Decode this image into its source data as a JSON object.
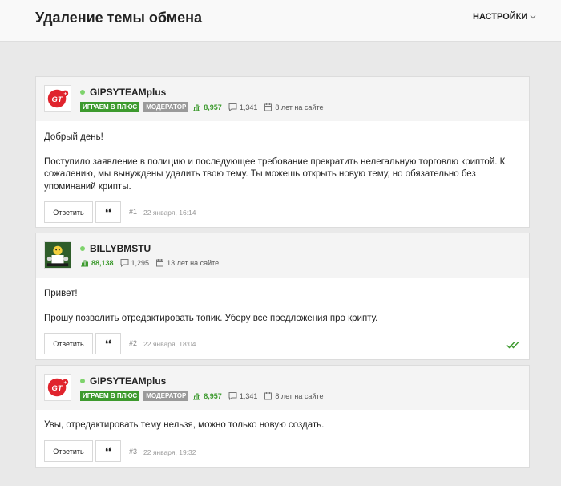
{
  "header": {
    "title": "Удаление темы обмена",
    "settings_label": "НАСТРОЙКИ"
  },
  "posts": [
    {
      "author": "GIPSYTEAMplus",
      "badge_group": "ИГРАЕМ В ПЛЮС",
      "badge_role": "МОДЕРАТОР",
      "reputation": "8,957",
      "messages": "1,341",
      "on_site": "8 лет на сайте",
      "paragraphs": [
        "Добрый день!",
        "Поступило заявление в полицию и последующее требование прекратить нелегальную торговлю криптой. К сожалению, мы вынуждены удалить твою тему. Ты можешь открыть новую тему, но обязательно без упоминаний крипты."
      ],
      "reply_label": "Ответить",
      "quote_label": "❛❛",
      "number": "#1",
      "date": "22 января, 16:14"
    },
    {
      "author": "BILLYBMSTU",
      "reputation": "88,138",
      "messages": "1,295",
      "on_site": "13 лет на сайте",
      "paragraphs": [
        "Привет!",
        "Прошу позволить отредактировать топик. Уберу все предложения про крипту."
      ],
      "reply_label": "Ответить",
      "quote_label": "❛❛",
      "number": "#2",
      "date": "22 января, 18:04"
    },
    {
      "author": "GIPSYTEAMplus",
      "badge_group": "ИГРАЕМ В ПЛЮС",
      "badge_role": "МОДЕРАТОР",
      "reputation": "8,957",
      "messages": "1,341",
      "on_site": "8 лет на сайте",
      "paragraphs": [
        "Увы, отредактировать тему нельзя, можно только новую создать."
      ],
      "reply_label": "Ответить",
      "quote_label": "❛❛",
      "number": "#3",
      "date": "22 января, 19:32"
    }
  ],
  "colors": {
    "accent_green": "#3d9a2e",
    "logo_red": "#e0242d",
    "online": "#7ed36c"
  },
  "icons": [
    "chevron-down-icon",
    "reputation-chart-icon",
    "messages-icon",
    "calendar-icon",
    "double-check-icon",
    "gipsyteam-logo",
    "poker-avatar"
  ]
}
